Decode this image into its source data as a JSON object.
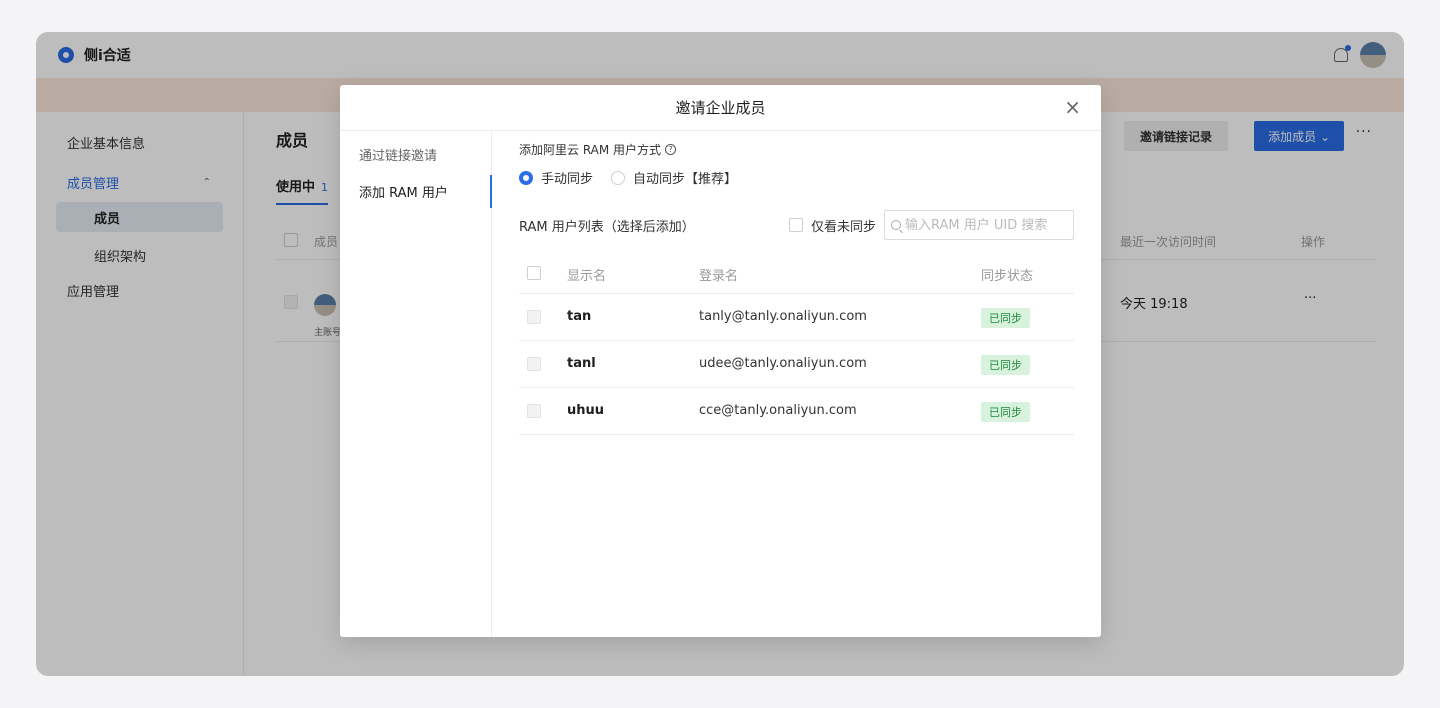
{
  "app": {
    "title": "侧i合适"
  },
  "sidebar": {
    "items": [
      {
        "label": "企业基本信息"
      },
      {
        "label": "成员管理",
        "expanded": true
      },
      {
        "label": "应用管理"
      }
    ],
    "sub_items": [
      {
        "label": "成员",
        "selected": true
      },
      {
        "label": "组织架构"
      }
    ]
  },
  "main": {
    "title": "成员",
    "tab_label": "使用中",
    "tab_count": "1",
    "records_button": "邀请链接记录",
    "add_button": "添加成员",
    "more": "···",
    "columns": {
      "member": "成员",
      "last_visit": "最近一次访问时间",
      "actions": "操作"
    },
    "row": {
      "sub_label": "主账号",
      "last_visit": "今天 19:18",
      "actions": "···"
    }
  },
  "dialog": {
    "title": "邀请企业成员",
    "close": "×",
    "nav": [
      {
        "label": "通过链接邀请",
        "active": false
      },
      {
        "label": "添加 RAM 用户",
        "active": true
      }
    ],
    "method_label": "添加阿里云 RAM 用户方式",
    "help": "?",
    "radio": {
      "manual": "手动同步",
      "auto": "自动同步【推荐】",
      "selected": "manual"
    },
    "list_label": "RAM 用户列表（选择后添加）",
    "only_unsync": "仅看未同步",
    "search_placeholder": "输入RAM 用户 UID 搜索",
    "columns": {
      "display_name": "显示名",
      "login_name": "登录名",
      "sync_status": "同步状态"
    },
    "rows": [
      {
        "display_name": "tan",
        "login_name": "tanly@tanly.onaliyun.com",
        "status": "已同步"
      },
      {
        "display_name": "tanl",
        "login_name": "udee@tanly.onaliyun.com",
        "status": "已同步"
      },
      {
        "display_name": "uhuu",
        "login_name": "cce@tanly.onaliyun.com",
        "status": "已同步"
      }
    ]
  },
  "colors": {
    "accent": "#2b6de5",
    "synced_text": "#1f8a3a",
    "synced_bg": "#d9f2dd",
    "banner": "#fbe9dc"
  },
  "icons": [
    "logo-icon",
    "bell-icon",
    "avatar",
    "chevron-up-icon",
    "chevron-down-icon",
    "close-icon",
    "help-icon",
    "search-icon"
  ]
}
